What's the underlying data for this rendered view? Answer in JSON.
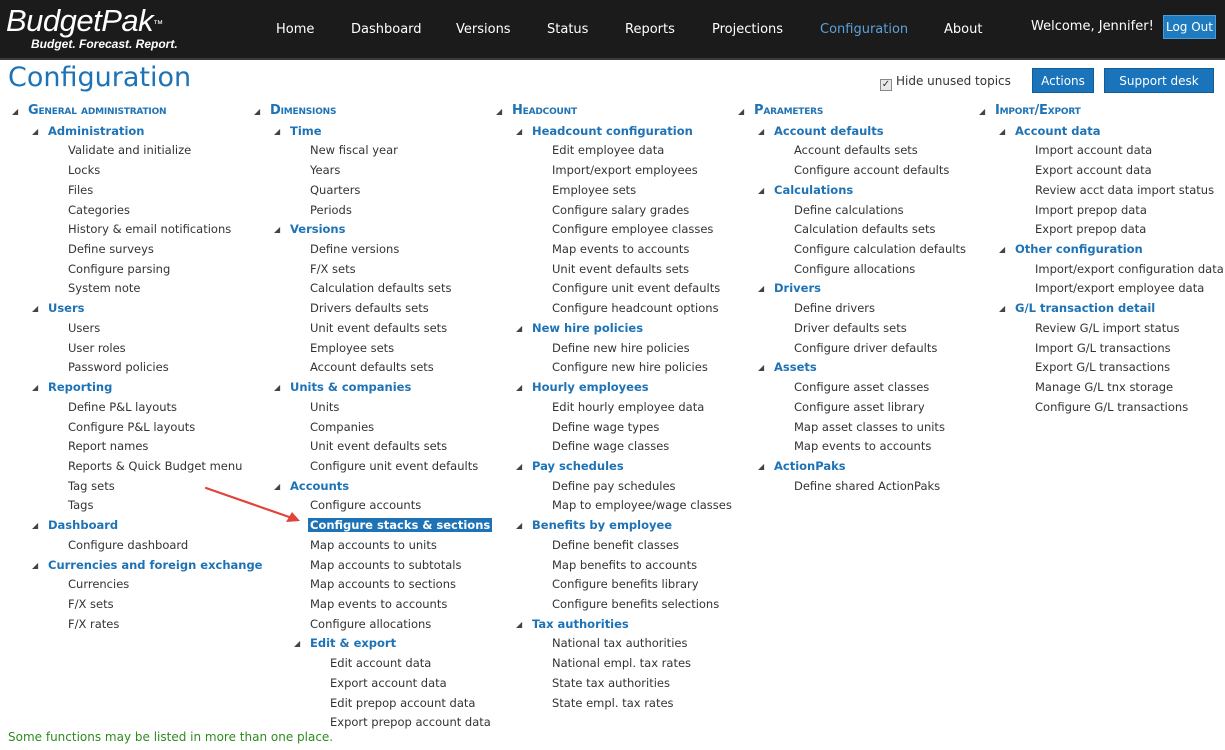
{
  "app": {
    "logo_main": "BudgetPak",
    "logo_tm": "™",
    "tagline": "Budget. Forecast. Report."
  },
  "nav": [
    {
      "label": "Home",
      "active": false
    },
    {
      "label": "Dashboard",
      "active": false
    },
    {
      "label": "Versions",
      "active": false
    },
    {
      "label": "Status",
      "active": false
    },
    {
      "label": "Reports",
      "active": false
    },
    {
      "label": "Projections",
      "active": false
    },
    {
      "label": "Configuration",
      "active": true
    },
    {
      "label": "About",
      "active": false
    }
  ],
  "user": {
    "welcome": "Welcome, Jennifer!",
    "logout_label": "Log Out"
  },
  "page": {
    "title": "Configuration",
    "hide_unused_label": "Hide unused topics",
    "hide_unused_checked": true,
    "actions_label": "Actions",
    "support_label": "Support desk",
    "footer_note": "Some functions may be listed in more than one place."
  },
  "columns": [
    {
      "rows": [
        {
          "t": "cat",
          "text": "General administration"
        },
        {
          "t": "sub",
          "text": "Administration"
        },
        {
          "t": "leaf",
          "text": "Validate and initialize"
        },
        {
          "t": "leaf",
          "text": "Locks"
        },
        {
          "t": "leaf",
          "text": "Files"
        },
        {
          "t": "leaf",
          "text": "Categories"
        },
        {
          "t": "leaf",
          "text": "History & email notifications"
        },
        {
          "t": "leaf",
          "text": "Define surveys"
        },
        {
          "t": "leaf",
          "text": "Configure parsing"
        },
        {
          "t": "leaf",
          "text": "System note"
        },
        {
          "t": "sub",
          "text": "Users"
        },
        {
          "t": "leaf",
          "text": "Users"
        },
        {
          "t": "leaf",
          "text": "User roles"
        },
        {
          "t": "leaf",
          "text": "Password policies"
        },
        {
          "t": "sub",
          "text": "Reporting"
        },
        {
          "t": "leaf",
          "text": "Define P&L layouts"
        },
        {
          "t": "leaf",
          "text": "Configure P&L layouts"
        },
        {
          "t": "leaf",
          "text": "Report names"
        },
        {
          "t": "leaf",
          "text": "Reports & Quick Budget menu"
        },
        {
          "t": "leaf",
          "text": "Tag sets"
        },
        {
          "t": "leaf",
          "text": "Tags"
        },
        {
          "t": "sub",
          "text": "Dashboard"
        },
        {
          "t": "leaf",
          "text": "Configure dashboard"
        },
        {
          "t": "sub",
          "text": "Currencies and foreign exchange"
        },
        {
          "t": "leaf",
          "text": "Currencies"
        },
        {
          "t": "leaf",
          "text": "F/X sets"
        },
        {
          "t": "leaf",
          "text": "F/X rates"
        }
      ]
    },
    {
      "rows": [
        {
          "t": "cat",
          "text": "Dimensions"
        },
        {
          "t": "sub",
          "text": "Time"
        },
        {
          "t": "leaf",
          "text": "New fiscal year"
        },
        {
          "t": "leaf",
          "text": "Years"
        },
        {
          "t": "leaf",
          "text": "Quarters"
        },
        {
          "t": "leaf",
          "text": "Periods"
        },
        {
          "t": "sub",
          "text": "Versions"
        },
        {
          "t": "leaf",
          "text": "Define versions"
        },
        {
          "t": "leaf",
          "text": "F/X sets"
        },
        {
          "t": "leaf",
          "text": "Calculation defaults sets"
        },
        {
          "t": "leaf",
          "text": "Drivers defaults sets"
        },
        {
          "t": "leaf",
          "text": "Unit event defaults sets"
        },
        {
          "t": "leaf",
          "text": "Employee sets"
        },
        {
          "t": "leaf",
          "text": "Account defaults sets"
        },
        {
          "t": "sub",
          "text": "Units & companies"
        },
        {
          "t": "leaf",
          "text": "Units"
        },
        {
          "t": "leaf",
          "text": "Companies"
        },
        {
          "t": "leaf",
          "text": "Unit event defaults sets"
        },
        {
          "t": "leaf",
          "text": "Configure unit event defaults"
        },
        {
          "t": "sub",
          "text": "Accounts"
        },
        {
          "t": "leaf",
          "text": "Configure accounts"
        },
        {
          "t": "leaf",
          "text": "Configure stacks & sections",
          "highlight": true
        },
        {
          "t": "leaf",
          "text": "Map accounts to units"
        },
        {
          "t": "leaf",
          "text": "Map accounts to subtotals"
        },
        {
          "t": "leaf",
          "text": "Map accounts to sections"
        },
        {
          "t": "leaf",
          "text": "Map events to accounts"
        },
        {
          "t": "leaf",
          "text": "Configure allocations"
        },
        {
          "t": "sub2",
          "text": "Edit & export"
        },
        {
          "t": "leaf2",
          "text": "Edit account data"
        },
        {
          "t": "leaf2",
          "text": "Export account data"
        },
        {
          "t": "leaf2",
          "text": "Edit prepop account data"
        },
        {
          "t": "leaf2",
          "text": "Export prepop account data"
        }
      ]
    },
    {
      "rows": [
        {
          "t": "cat",
          "text": "Headcount"
        },
        {
          "t": "sub",
          "text": "Headcount configuration"
        },
        {
          "t": "leaf",
          "text": "Edit employee data"
        },
        {
          "t": "leaf",
          "text": "Import/export employees"
        },
        {
          "t": "leaf",
          "text": "Employee sets"
        },
        {
          "t": "leaf",
          "text": "Configure salary grades"
        },
        {
          "t": "leaf",
          "text": "Configure employee classes"
        },
        {
          "t": "leaf",
          "text": "Map events to accounts"
        },
        {
          "t": "leaf",
          "text": "Unit event defaults sets"
        },
        {
          "t": "leaf",
          "text": "Configure unit event defaults"
        },
        {
          "t": "leaf",
          "text": "Configure headcount options"
        },
        {
          "t": "sub",
          "text": "New hire policies"
        },
        {
          "t": "leaf",
          "text": "Define new hire policies"
        },
        {
          "t": "leaf",
          "text": "Configure new hire policies"
        },
        {
          "t": "sub",
          "text": "Hourly employees"
        },
        {
          "t": "leaf",
          "text": "Edit hourly employee data"
        },
        {
          "t": "leaf",
          "text": "Define wage types"
        },
        {
          "t": "leaf",
          "text": "Define wage classes"
        },
        {
          "t": "sub",
          "text": "Pay schedules"
        },
        {
          "t": "leaf",
          "text": "Define pay schedules"
        },
        {
          "t": "leaf",
          "text": "Map to employee/wage classes"
        },
        {
          "t": "sub",
          "text": "Benefits by employee"
        },
        {
          "t": "leaf",
          "text": "Define benefit classes"
        },
        {
          "t": "leaf",
          "text": "Map benefits to accounts"
        },
        {
          "t": "leaf",
          "text": "Configure benefits library"
        },
        {
          "t": "leaf",
          "text": "Configure benefits selections"
        },
        {
          "t": "sub",
          "text": "Tax authorities"
        },
        {
          "t": "leaf",
          "text": "National tax authorities"
        },
        {
          "t": "leaf",
          "text": "National empl. tax rates"
        },
        {
          "t": "leaf",
          "text": "State tax authorities"
        },
        {
          "t": "leaf",
          "text": "State empl. tax rates"
        }
      ]
    },
    {
      "rows": [
        {
          "t": "cat",
          "text": "Parameters"
        },
        {
          "t": "sub",
          "text": "Account defaults"
        },
        {
          "t": "leaf",
          "text": "Account defaults sets"
        },
        {
          "t": "leaf",
          "text": "Configure account defaults"
        },
        {
          "t": "sub",
          "text": "Calculations"
        },
        {
          "t": "leaf",
          "text": "Define calculations"
        },
        {
          "t": "leaf",
          "text": "Calculation defaults sets"
        },
        {
          "t": "leaf",
          "text": "Configure calculation defaults"
        },
        {
          "t": "leaf",
          "text": "Configure allocations"
        },
        {
          "t": "sub",
          "text": "Drivers"
        },
        {
          "t": "leaf",
          "text": "Define drivers"
        },
        {
          "t": "leaf",
          "text": "Driver defaults sets"
        },
        {
          "t": "leaf",
          "text": "Configure driver defaults"
        },
        {
          "t": "sub",
          "text": "Assets"
        },
        {
          "t": "leaf",
          "text": "Configure asset classes"
        },
        {
          "t": "leaf",
          "text": "Configure asset library"
        },
        {
          "t": "leaf",
          "text": "Map asset classes to units"
        },
        {
          "t": "leaf",
          "text": "Map events to accounts"
        },
        {
          "t": "sub",
          "text": "ActionPaks"
        },
        {
          "t": "leaf",
          "text": "Define shared ActionPaks"
        }
      ]
    },
    {
      "rows": [
        {
          "t": "cat",
          "text": "Import/Export"
        },
        {
          "t": "sub",
          "text": "Account data"
        },
        {
          "t": "leaf",
          "text": "Import account data"
        },
        {
          "t": "leaf",
          "text": "Export account data"
        },
        {
          "t": "leaf",
          "text": "Review acct data import status"
        },
        {
          "t": "leaf",
          "text": "Import prepop data"
        },
        {
          "t": "leaf",
          "text": "Export prepop data"
        },
        {
          "t": "sub",
          "text": "Other configuration"
        },
        {
          "t": "leaf",
          "text": "Import/export configuration data"
        },
        {
          "t": "leaf",
          "text": "Import/export employee data"
        },
        {
          "t": "sub",
          "text": "G/L transaction detail"
        },
        {
          "t": "leaf",
          "text": "Review G/L import status"
        },
        {
          "t": "leaf",
          "text": "Import G/L transactions"
        },
        {
          "t": "leaf",
          "text": "Export G/L transactions"
        },
        {
          "t": "leaf",
          "text": "Manage G/L tnx storage"
        },
        {
          "t": "leaf",
          "text": "Configure G/L transactions"
        }
      ]
    }
  ]
}
